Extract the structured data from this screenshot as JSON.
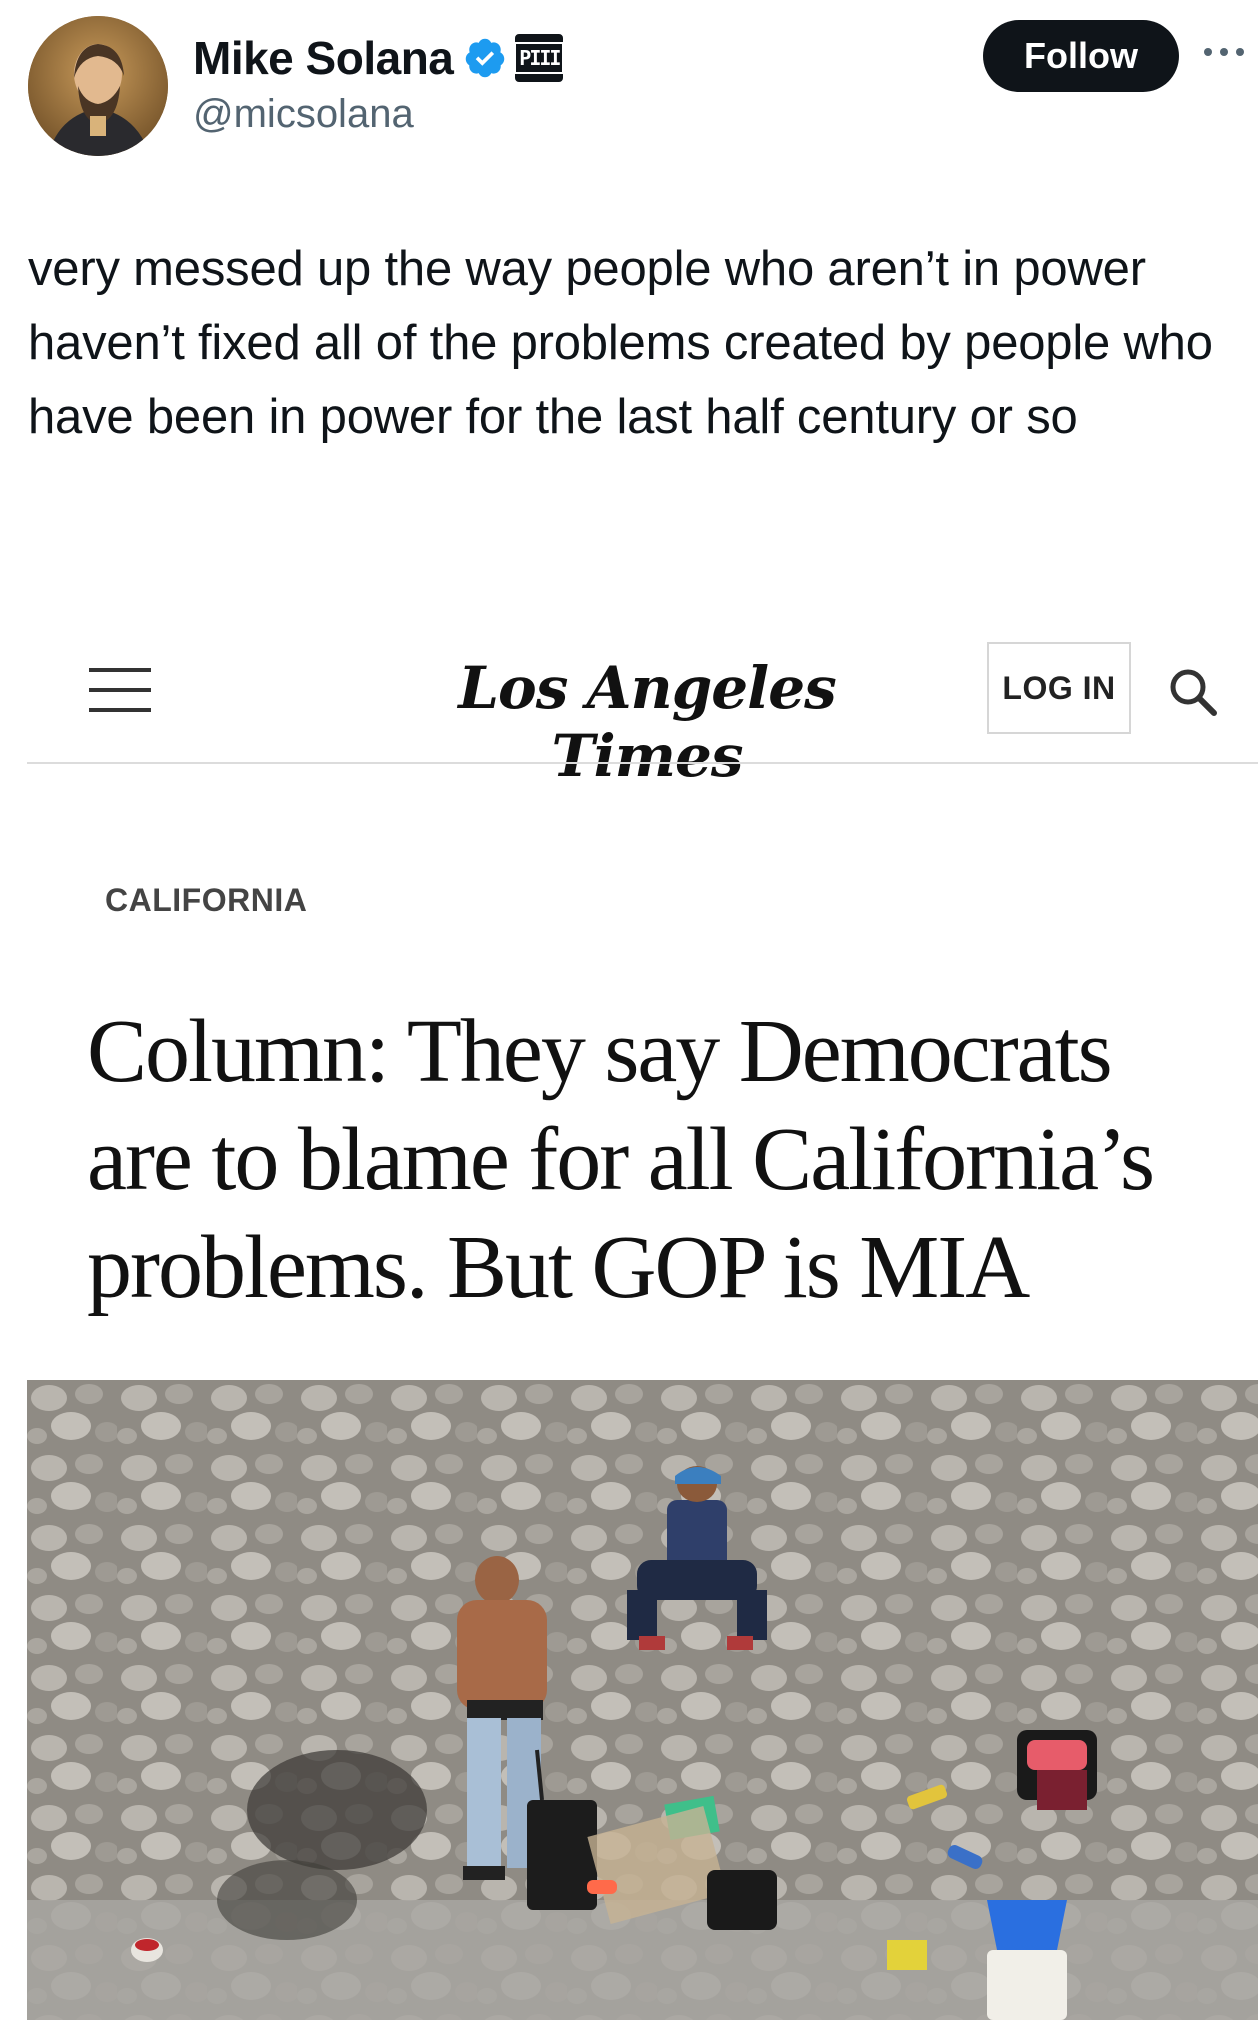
{
  "author": {
    "display_name": "Mike Solana",
    "handle": "@micsolana",
    "affiliate_badge": "PIII",
    "verified_color": "#1d9bf0"
  },
  "actions": {
    "follow_label": "Follow",
    "more_icon": "more-horizontal-icon"
  },
  "tweet": {
    "text": "very messed up the way people who aren’t in power haven’t fixed all of the problems created by people who have been in power for the last half century or so"
  },
  "card": {
    "nav": {
      "menu_icon": "hamburger-menu-icon",
      "masthead": "Los Angeles Times",
      "login_label": "LOG IN",
      "search_icon": "search-icon"
    },
    "section": "CALIFORNIA",
    "headline": "Column: They say Democrats are to blame for all California’s problems. But GOP is MIA"
  }
}
